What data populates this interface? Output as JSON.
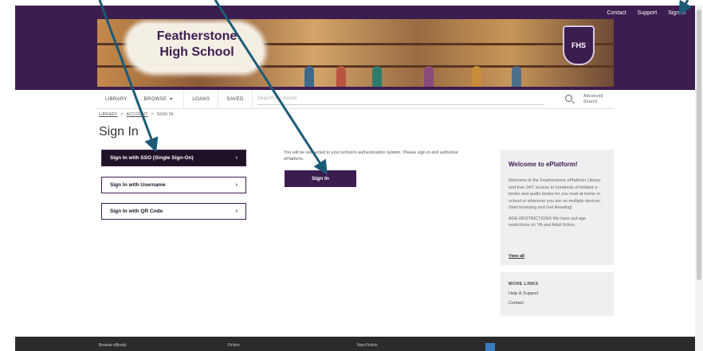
{
  "utility_links": [
    "Contact",
    "Support",
    "Sign In"
  ],
  "banner": {
    "school_line1": "Featherstone",
    "school_line2": "High School",
    "crest_text": "FHS"
  },
  "nav": {
    "items": [
      "LIBRARY",
      "BROWSE",
      "LOANS",
      "SAVED"
    ],
    "browse_chevron": "▾",
    "search_placeholder": "Search for books",
    "advanced_search": "Advanced Search"
  },
  "breadcrumb": [
    "LIBRARY",
    "ACCOUNT",
    "SIGN IN"
  ],
  "breadcrumb_sep": ">",
  "page_title": "Sign In",
  "sign_in_options": [
    {
      "label": "Sign In with SSO (Single Sign-On)",
      "chevron": "›"
    },
    {
      "label": "Sign In with Username",
      "chevron": "›"
    },
    {
      "label": "Sign In with QR Code",
      "chevron": "›"
    }
  ],
  "sso_info": "You will be redirected to your school's authentication system. Please sign in and authorise ePlatform.",
  "sign_in_button": "Sign In",
  "welcome": {
    "title": "Welcome to ePlatform!",
    "body": "Welcome to the Featherstone ePlatform Library and free 24/7 access to hundreds of brilliant e-books and audio books for you read at home or school or wherever you are on multiple devices. Start browsing and Get Reading!",
    "age": "AGE RESTRICTIONS We have put age restrictions on YA and Adult fiction.",
    "view_all": "View all"
  },
  "more_links": {
    "title": "MORE LINKS",
    "items": [
      "Help & Support",
      "Contact"
    ]
  },
  "footer": [
    "Browse eBooks",
    "Fiction",
    "Non-Fiction"
  ],
  "colors": {
    "brand_purple": "#3b1d4f",
    "dark_button": "#1e1326",
    "annotation_arrow": "#1c5a78"
  },
  "icons": [
    "search-icon",
    "chevron-right-icon",
    "chevron-down-icon",
    "school-crest-icon"
  ]
}
